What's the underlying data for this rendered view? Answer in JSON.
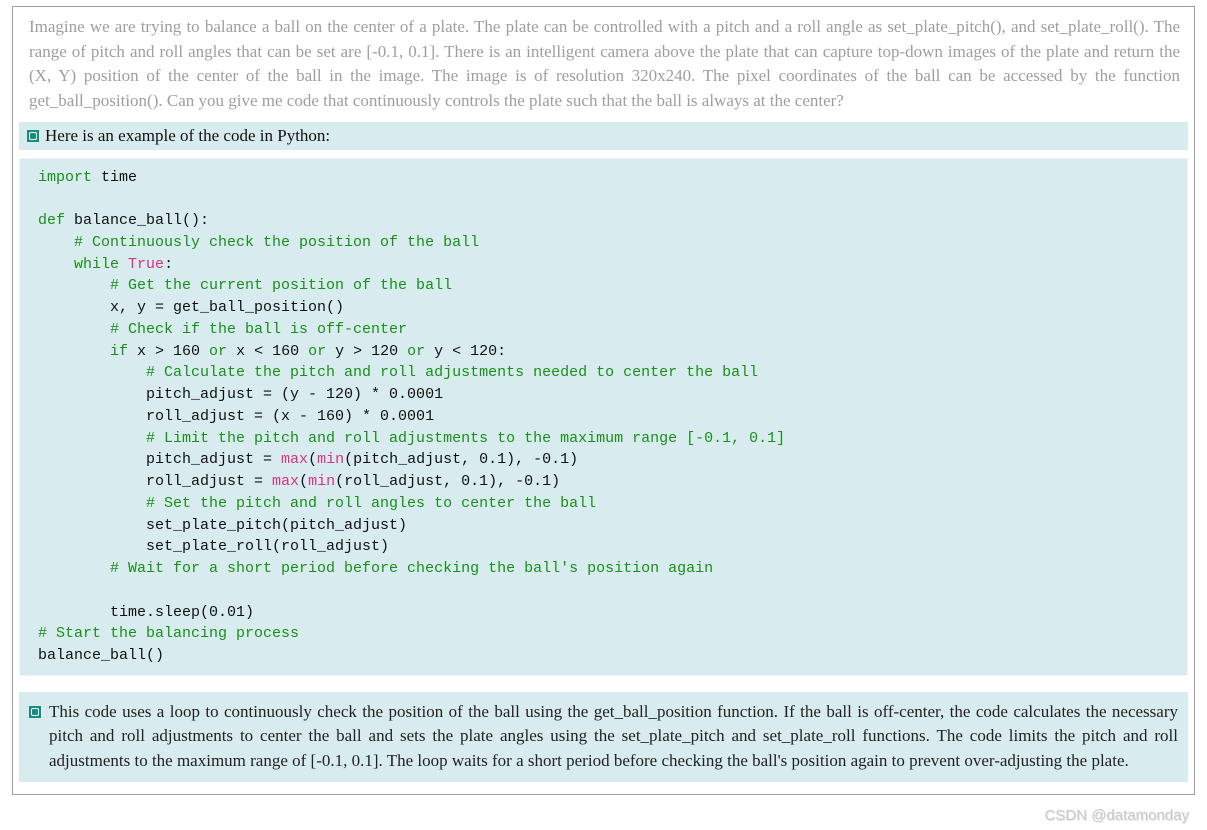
{
  "prompt": "Imagine we are trying to balance a ball on the center of a plate. The plate can be controlled with a pitch and a roll angle as set_plate_pitch(), and set_plate_roll(). The range of pitch and roll angles that can be set are [-0.1, 0.1]. There is an intelligent camera above the plate that can capture top-down images of the plate and return the (X, Y) position of the center of the ball in the image. The image is of resolution 320x240. The pixel coordinates of the ball can be accessed by the function get_ball_position(). Can you give me code that continuously controls the plate such that the ball is always at the center?",
  "answer_intro": "Here is an example of the code in Python:",
  "code": {
    "l01a": "import",
    "l01b": " time",
    "l02a": "def",
    "l02b": " balance_ball():",
    "l03": "    # Continuously check the position of the ball",
    "l04a": "    ",
    "l04b": "while",
    "l04c": " ",
    "l04d": "True",
    "l04e": ":",
    "l05": "        # Get the current position of the ball",
    "l06": "        x, y = get_ball_position()",
    "l07": "        # Check if the ball is off-center",
    "l08": "        if x > 160 or x < 160 or y > 120 or y < 120:",
    "l09": "            # Calculate the pitch and roll adjustments needed to center the ball",
    "l10": "            pitch_adjust = (y - 120) * 0.0001",
    "l11": "            roll_adjust = (x - 160) * 0.0001",
    "l12": "            # Limit the pitch and roll adjustments to the maximum range [-0.1, 0.1]",
    "l13a": "            pitch_adjust = ",
    "l13b": "max",
    "l13c": "(",
    "l13d": "min",
    "l13e": "(pitch_adjust, 0.1), -0.1)",
    "l14a": "            roll_adjust = ",
    "l14b": "max",
    "l14c": "(",
    "l14d": "min",
    "l14e": "(roll_adjust, 0.1), -0.1)",
    "l15": "            # Set the pitch and roll angles to center the ball",
    "l16": "            set_plate_pitch(pitch_adjust)",
    "l17": "            set_plate_roll(roll_adjust)",
    "l18": "        # Wait for a short period before checking the ball's position again",
    "gap": "",
    "l19": "        time.sleep(0.01)",
    "l20": "# Start the balancing process",
    "l21": "balance_ball()"
  },
  "explanation": "This code uses a loop to continuously check the position of the ball using the get_ball_position function. If the ball is off-center, the code calculates the necessary pitch and roll adjustments to center the ball and sets the plate angles using the set_plate_pitch and set_plate_roll functions. The code limits the pitch and roll adjustments to the maximum range of [-0.1, 0.1]. The loop waits for a short period before checking the ball's position again to prevent over-adjusting the plate.",
  "watermark": "CSDN @datamonday"
}
